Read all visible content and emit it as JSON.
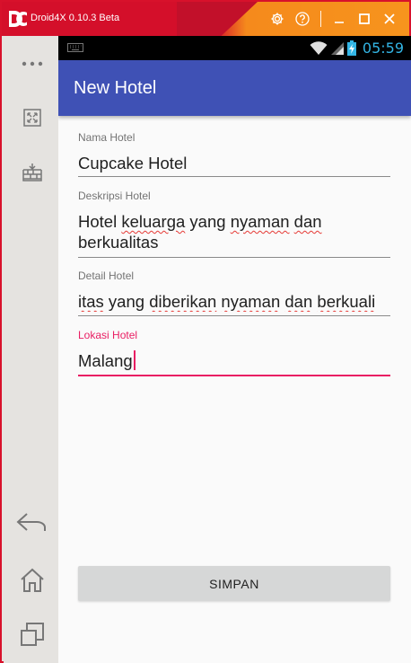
{
  "emulator": {
    "title": "Droid4X 0.10.3 Beta"
  },
  "statusbar": {
    "time": "05:59"
  },
  "appbar": {
    "title": "New Hotel"
  },
  "form": {
    "fields": [
      {
        "label": "Nama Hotel",
        "value": "Cupcake Hotel"
      },
      {
        "label": "Deskripsi Hotel",
        "value": "Hotel keluarga yang nyaman dan berkualitas"
      },
      {
        "label": "Detail Hotel",
        "value": "itas yang diberikan nyaman dan berkuali"
      },
      {
        "label": "Lokasi Hotel",
        "value": "Malang"
      }
    ],
    "submit_label": "SIMPAN"
  },
  "colors": {
    "appbar": "#3f51b5",
    "accent": "#e91e63",
    "emulator_red": "#d40f2a",
    "emulator_orange": "#f7941d"
  }
}
